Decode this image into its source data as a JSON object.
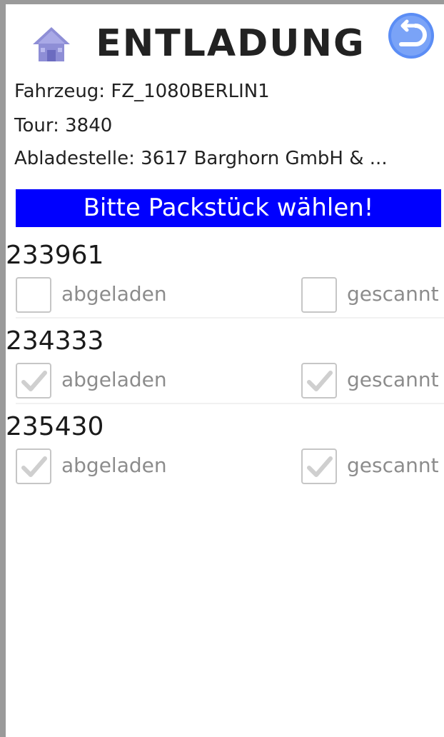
{
  "header": {
    "title": "ENTLADUNG",
    "home_icon": "home-icon",
    "back_icon": "back-arrow-icon"
  },
  "info": {
    "vehicle": "Fahrzeug: FZ_1080BERLIN1",
    "tour": "Tour: 3840",
    "stop": "Abladestelle: 3617 Barghorn GmbH & ..."
  },
  "banner": {
    "text": "Bitte Packstück wählen!"
  },
  "packages": [
    {
      "number": "233961",
      "unloaded_label": "abgeladen",
      "scanned_label": "gescannt",
      "unloaded": false,
      "scanned": false
    },
    {
      "number": "234333",
      "unloaded_label": "abgeladen",
      "scanned_label": "gescannt",
      "unloaded": true,
      "scanned": true
    },
    {
      "number": "235430",
      "unloaded_label": "abgeladen",
      "scanned_label": "gescannt",
      "unloaded": true,
      "scanned": true
    }
  ],
  "colors": {
    "banner_bg": "#0000ff",
    "banner_text": "#ffffff",
    "home_icon": "#8e8ed6",
    "back_button": "#5b8df5",
    "checkmark_disabled": "#cfcfcf"
  }
}
